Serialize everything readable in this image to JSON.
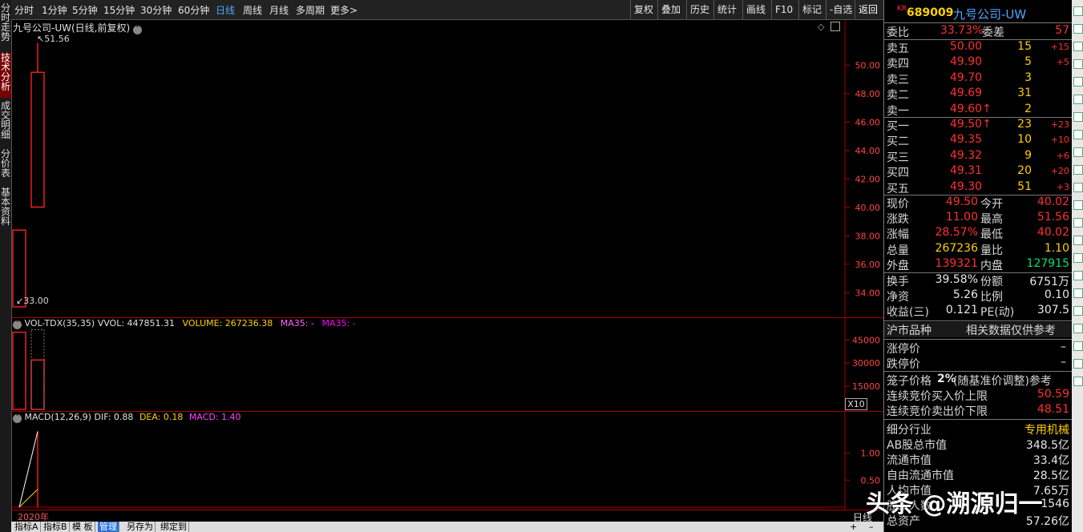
{
  "left_tabs": [
    "分时走势",
    "技术分析",
    "成交明细",
    "分价表",
    "基本资料"
  ],
  "toolbar": {
    "periods": [
      "分时",
      "1分钟",
      "5分钟",
      "15分钟",
      "30分钟",
      "60分钟",
      "日线",
      "周线",
      "月线",
      "多周期",
      "更多>"
    ],
    "active_period": "日线",
    "tools": [
      "复权",
      "叠加",
      "历史",
      "统计",
      "画线",
      "F10",
      "标记",
      "-自选",
      "返回"
    ]
  },
  "main_chart": {
    "title": "九号公司-UW(日线,前复权)",
    "high_label": "51.56",
    "low_label": "33.00",
    "y_ticks": [
      "50.00",
      "48.00",
      "46.00",
      "44.00",
      "42.00",
      "40.00",
      "38.00",
      "36.00",
      "34.00"
    ]
  },
  "volume_chart": {
    "title_prefix": "VOL-TDX(35,35)",
    "vvol": "VVOL: 447851.31",
    "volume": "VOLUME: 267236.38",
    "ma35a": "MA35: -",
    "ma35b": "MA35: -",
    "y_ticks": [
      "45000",
      "30000",
      "15000"
    ],
    "multiplier": "X10"
  },
  "macd_chart": {
    "title_prefix": "MACD(12,26,9)",
    "dif": "DIF: 0.88",
    "dea": "DEA: 0.18",
    "macd": "MACD: 1.40",
    "y_ticks": [
      "1.00",
      "0.50"
    ],
    "year": "2020年",
    "corner": "日线"
  },
  "chart_data": {
    "type": "candlestick",
    "candles": [
      {
        "open": 38.4,
        "close": 33.0,
        "high": 38.4,
        "low": 33.0
      },
      {
        "open": 40.02,
        "close": 49.5,
        "high": 51.56,
        "low": 40.02
      }
    ],
    "volume": [
      50000,
      32000
    ],
    "macd": [
      0.55,
      1.4
    ],
    "ylim": [
      33.0,
      52.5
    ]
  },
  "quote": {
    "code_prefix": "KR",
    "code": "689009",
    "name": "九号公司-UW",
    "weibi_label": "委比",
    "weibi": "33.73%",
    "weicha_label": "委差",
    "weicha": "57",
    "asks": [
      {
        "label": "卖五",
        "price": "50.00",
        "vol": "15",
        "chg": "+15"
      },
      {
        "label": "卖四",
        "price": "49.90",
        "vol": "5",
        "chg": "+5"
      },
      {
        "label": "卖三",
        "price": "49.70",
        "vol": "3",
        "chg": ""
      },
      {
        "label": "卖二",
        "price": "49.69",
        "vol": "31",
        "chg": ""
      },
      {
        "label": "卖一",
        "price": "49.60↑",
        "vol": "2",
        "chg": ""
      }
    ],
    "bids": [
      {
        "label": "买一",
        "price": "49.50↑",
        "vol": "23",
        "chg": "+23"
      },
      {
        "label": "买二",
        "price": "49.35",
        "vol": "10",
        "chg": "+10"
      },
      {
        "label": "买三",
        "price": "49.32",
        "vol": "9",
        "chg": "+6"
      },
      {
        "label": "买四",
        "price": "49.31",
        "vol": "20",
        "chg": "+20"
      },
      {
        "label": "买五",
        "price": "49.30",
        "vol": "51",
        "chg": "+3"
      }
    ],
    "stats": [
      {
        "l1": "现价",
        "v1": "49.50",
        "l2": "今开",
        "v2": "40.02"
      },
      {
        "l1": "涨跌",
        "v1": "11.00",
        "l2": "最高",
        "v2": "51.56"
      },
      {
        "l1": "涨幅",
        "v1": "28.57%",
        "l2": "最低",
        "v2": "40.02"
      },
      {
        "l1": "总量",
        "v1": "267236",
        "l2": "量比",
        "v2": "1.10"
      },
      {
        "l1": "外盘",
        "v1": "139321",
        "l2": "内盘",
        "v2": "127915"
      }
    ],
    "stats2": [
      {
        "l1": "换手",
        "v1": "39.58%",
        "l2": "份额",
        "v2": "6751万"
      },
      {
        "l1": "净资",
        "v1": "5.26",
        "l2": "比例",
        "v2": "0.10"
      },
      {
        "l1": "收益(三)",
        "v1": "0.121",
        "l2": "PE(动)",
        "v2": "307.5"
      }
    ],
    "market_label": "沪市品种",
    "market_note": "相关数据仅供参考",
    "limit_up_label": "涨停价",
    "limit_up": "–",
    "limit_down_label": "跌停价",
    "limit_down": "–",
    "cage_label": "笼子价格",
    "cage_pct": "2%",
    "cage_note": "(随基准价调整)参考",
    "bid_cap_label": "连续竞价买入价上限",
    "bid_cap": "50.59",
    "ask_floor_label": "连续竞价卖出价下限",
    "ask_floor": "48.51",
    "industry_label": "细分行业",
    "industry": "专用机械",
    "ab_cap_label": "AB股总市值",
    "ab_cap": "348.5亿",
    "float_cap_label": "流通市值",
    "float_cap": "33.4亿",
    "free_cap_label": "自由流通市值",
    "free_cap": "28.5亿",
    "people_label": "人均市值",
    "people": "7.65万",
    "holders_label": "股东人数",
    "holders": "1546",
    "assets_label": "总资产",
    "assets": "57.26亿"
  },
  "bottom_tabs": [
    "指标A",
    "指标B",
    "模 板",
    "管理",
    "另存为",
    "绑定到"
  ],
  "active_bottom_tab": "管理",
  "watermark": "头条 @溯源归一",
  "colors": {
    "up": "#ff3030",
    "down": "#00e070",
    "accent": "#4fa3ff",
    "background": "#000000"
  }
}
